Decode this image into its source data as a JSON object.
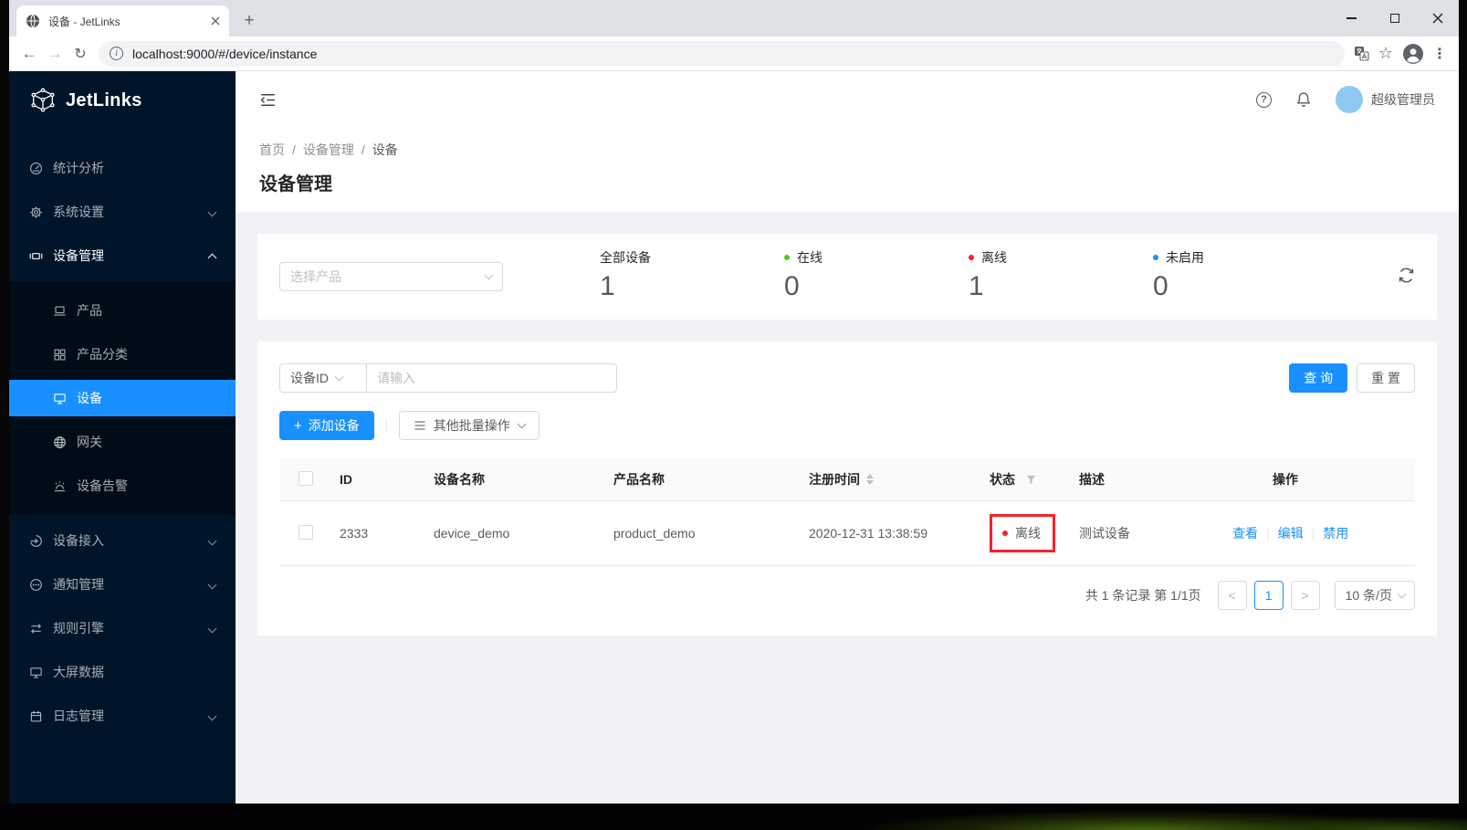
{
  "browser": {
    "tab_title": "设备 - JetLinks",
    "url": "localhost:9000/#/device/instance"
  },
  "sidebar": {
    "logo_text": "JetLinks",
    "menu": {
      "stats": "统计分析",
      "system_settings": "系统设置",
      "device_mgmt": "设备管理",
      "product": "产品",
      "product_category": "产品分类",
      "device": "设备",
      "gateway": "网关",
      "device_alarm": "设备告警",
      "device_access": "设备接入",
      "notification": "通知管理",
      "rule_engine": "规则引擎",
      "big_screen": "大屏数据",
      "log_mgmt": "日志管理"
    }
  },
  "topbar": {
    "username": "超级管理员"
  },
  "breadcrumb": {
    "home": "首页",
    "section": "设备管理",
    "current": "设备",
    "separator": "/"
  },
  "page": {
    "title": "设备管理"
  },
  "stats_card": {
    "product_select_placeholder": "选择产品",
    "items": [
      {
        "label": "全部设备",
        "value": "1"
      },
      {
        "label": "在线",
        "value": "0",
        "dot_color": "#52c41a"
      },
      {
        "label": "离线",
        "value": "1",
        "dot_color": "#f5222d"
      },
      {
        "label": "未启用",
        "value": "0",
        "dot_color": "#1890ff"
      }
    ]
  },
  "query_card": {
    "field_select_value": "设备ID",
    "input_placeholder": "请输入",
    "search_button": "查 询",
    "reset_button": "重 置",
    "add_device_button": "添加设备",
    "batch_actions_button": "其他批量操作"
  },
  "table": {
    "headers": {
      "id": "ID",
      "device_name": "设备名称",
      "product_name": "产品名称",
      "register_time": "注册时间",
      "status": "状态",
      "description": "描述",
      "operation": "操作"
    },
    "row": {
      "id": "2333",
      "device_name": "device_demo",
      "product_name": "product_demo",
      "register_time": "2020-12-31 13:38:59",
      "status": "离线",
      "description": "测试设备",
      "op_view": "查看",
      "op_edit": "编辑",
      "op_disable": "禁用"
    }
  },
  "pagination": {
    "summary": "共 1 条记录 第 1/1页",
    "current_page": "1",
    "page_size": "10 条/页"
  },
  "colors": {
    "accent": "#1890ff",
    "online_green": "#52c41a",
    "offline_red": "#f5222d",
    "unactivated_blue": "#1890ff",
    "annotation_box_red": "#f5222d",
    "sidebar_bg": "#001529",
    "submenu_bg": "#000c17"
  }
}
